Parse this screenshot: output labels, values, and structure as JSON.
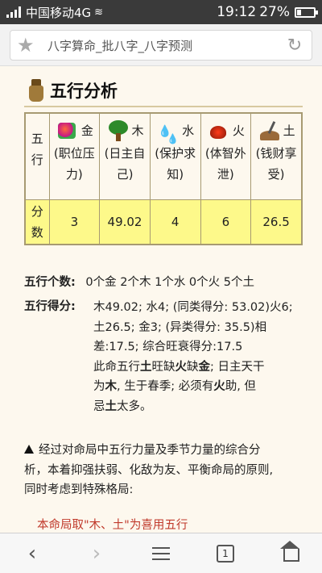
{
  "status": {
    "carrier": "中国移动4G",
    "time": "19:12",
    "battery": "27%",
    "battery_level": 0.27
  },
  "browser": {
    "page_title": "八字算命_批八字_八字预测"
  },
  "section": {
    "title": "五行分析"
  },
  "table": {
    "row_label_elements": [
      "五",
      "行"
    ],
    "row_label_scores": [
      "分",
      "数"
    ],
    "elements": [
      {
        "name": "金",
        "desc": [
          "(职位压",
          "力)"
        ],
        "icon": "gold-icon",
        "score": "3"
      },
      {
        "name": "木",
        "desc": [
          "(日主自",
          "己)"
        ],
        "icon": "wood-icon",
        "score": "49.02"
      },
      {
        "name": "水",
        "desc": [
          "(保护求",
          "知)"
        ],
        "icon": "water-icon",
        "score": "4"
      },
      {
        "name": "火",
        "desc": [
          "(体智外",
          "泄)"
        ],
        "icon": "fire-icon",
        "score": "6"
      },
      {
        "name": "土",
        "desc": [
          "(钱财享",
          "受)"
        ],
        "icon": "earth-icon",
        "score": "26.5"
      }
    ]
  },
  "counts": {
    "label": "五行个数:",
    "value": "0个金 2个木 1个水 0个火 5个土"
  },
  "scores": {
    "label": "五行得分:",
    "line1": "木49.02; 水4; (同类得分: 53.02)火6;",
    "line2": "土26.5; 金3; (异类得分: 35.5)相",
    "line3": "差:17.5; 综合旺衰得分:17.5",
    "line4_a": "此命五行",
    "line4_b": "土",
    "line4_c": "旺缺",
    "line4_d": "火",
    "line4_e": "缺",
    "line4_f": "金",
    "line4_g": "; 日主天干",
    "line5_a": "为",
    "line5_b": "木",
    "line5_c": ", 生于春季; 必须有",
    "line5_d": "火",
    "line5_e": "助, 但",
    "line6_a": "忌",
    "line6_b": "土",
    "line6_c": "太多。"
  },
  "analysis": {
    "line1": "经过对命局中五行力量及季节力量的综合分",
    "line2": "析，本着抑强扶弱、化敌为友、平衡命局的原则,",
    "line3": "同时考虑到特殊格局:",
    "result": "本命局取\"木、土\"为喜用五行"
  },
  "nav": {
    "tab_count": "1"
  },
  "colors": {
    "accent_red": "#c0392b",
    "score_row": "#fdf98a",
    "border": "#a79a72"
  }
}
